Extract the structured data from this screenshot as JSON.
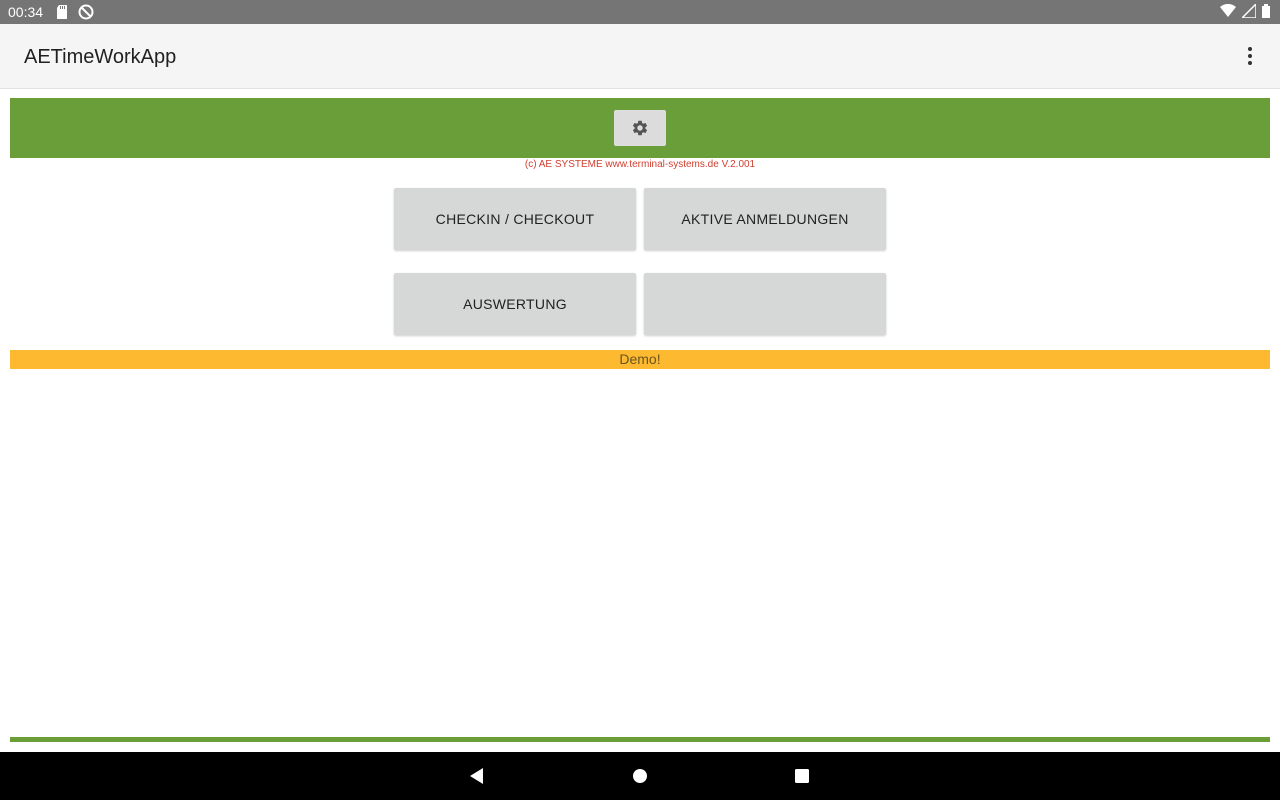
{
  "status_bar": {
    "time": "00:34",
    "icons": [
      "sd-card-icon",
      "sync-blocked-icon",
      "wifi-icon",
      "signal-icon",
      "battery-icon"
    ]
  },
  "app_bar": {
    "title": "AETimeWorkApp",
    "menu_icon": "more-vert-icon"
  },
  "header": {
    "settings_icon": "gear-icon",
    "copyright": "(c) AE SYSTEME www.terminal-systems.de V.2.001"
  },
  "tiles": [
    {
      "label": "CHECKIN / CHECKOUT"
    },
    {
      "label": "AKTIVE ANMELDUNGEN"
    },
    {
      "label": "AUSWERTUNG"
    },
    {
      "label": ""
    }
  ],
  "demo_banner": "Demo!",
  "nav_bar": {
    "buttons": [
      "back-icon",
      "home-icon",
      "recents-icon"
    ]
  },
  "colors": {
    "green": "#6a9e38",
    "demo": "#fdb92f",
    "tile": "#d6d7d7",
    "copyright_text": "#d04030"
  }
}
